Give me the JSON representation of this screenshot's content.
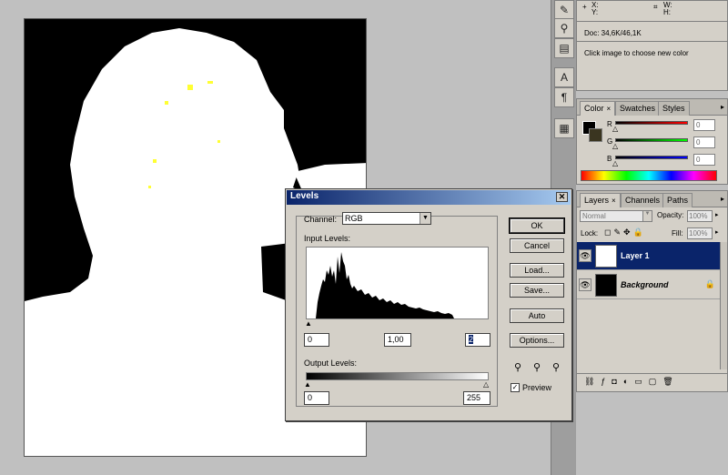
{
  "info": {
    "xy_label": "X:\nY:",
    "x_label": "X:",
    "y_label": "Y:",
    "w_label": "W:",
    "h_label": "H:",
    "doc": "Doc: 34,6K/46,1K",
    "hint": "Click image to choose new color"
  },
  "color_panel": {
    "tabs": [
      "Color",
      "Swatches",
      "Styles"
    ],
    "r_label": "R",
    "g_label": "G",
    "b_label": "B",
    "r_value": "0",
    "g_value": "0",
    "b_value": "0"
  },
  "layers_panel": {
    "tabs": [
      "Layers",
      "Channels",
      "Paths"
    ],
    "blend_mode": "Normal",
    "opacity_label": "Opacity:",
    "opacity_value": "100%",
    "lock_label": "Lock:",
    "fill_label": "Fill:",
    "fill_value": "100%",
    "layers": [
      {
        "name": "Layer 1",
        "selected": true
      },
      {
        "name": "Background",
        "selected": false
      }
    ]
  },
  "levels": {
    "title": "Levels",
    "channel_label": "Channel:",
    "channel_value": "RGB",
    "input_levels_label": "Input Levels:",
    "input_black": "0",
    "input_gamma": "1,00",
    "input_white": "2",
    "output_levels_label": "Output Levels:",
    "output_black": "0",
    "output_white": "255",
    "buttons": {
      "ok": "OK",
      "cancel": "Cancel",
      "load": "Load...",
      "save": "Save...",
      "auto": "Auto",
      "options": "Options..."
    },
    "preview_label": "Preview",
    "preview_checked": true
  },
  "colors": {
    "dialog_title_start": "#0a246a",
    "dialog_title_end": "#a6caf0",
    "layer_selected": "#0a246a",
    "panel_bg": "#d4d0c8",
    "workspace": "#c0c0c0"
  }
}
